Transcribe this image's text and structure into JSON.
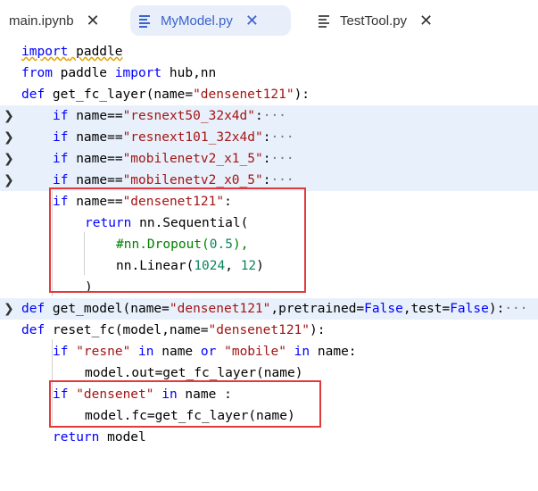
{
  "tabs": [
    {
      "label": "main.ipynb",
      "close": "✕"
    },
    {
      "label": "MyModel.py",
      "close": "✕"
    },
    {
      "label": "TestTool.py",
      "close": "✕"
    }
  ],
  "code": {
    "l1": {
      "kw": "import",
      "rest": " paddle"
    },
    "l2": {
      "kw1": "from",
      "mid": " paddle ",
      "kw2": "import",
      "rest": " hub,nn"
    },
    "l3": {
      "kw": "def",
      "a": " get_fc_layer(name=",
      "s": "\"densenet121\"",
      "b": "):"
    },
    "l4": {
      "kw": "if",
      "a": " name==",
      "s": "\"resnext50_32x4d\"",
      "b": ":",
      "e": "···"
    },
    "l5": {
      "kw": "if",
      "a": " name==",
      "s": "\"resnext101_32x4d\"",
      "b": ":",
      "e": "···"
    },
    "l6": {
      "kw": "if",
      "a": " name==",
      "s": "\"mobilenetv2_x1_5\"",
      "b": ":",
      "e": "···"
    },
    "l7": {
      "kw": "if",
      "a": " name==",
      "s": "\"mobilenetv2_x0_5\"",
      "b": ":",
      "e": "···"
    },
    "l8": {
      "kw": "if",
      "a": " name==",
      "s": "\"densenet121\"",
      "b": ":"
    },
    "l9": {
      "kw": "return",
      "a": " nn.Sequential("
    },
    "l10": {
      "c": "#nn.Dropout(",
      "n": "0.5",
      "d": "),"
    },
    "l11": {
      "a": "nn.Linear(",
      "n1": "1024",
      "m": ", ",
      "n2": "12",
      "b": ")"
    },
    "l12": {
      "a": ")"
    },
    "l13": {
      "kw": "def",
      "a": " get_model(name=",
      "s": "\"densenet121\"",
      "b": ",pretrained=",
      "f1": "False",
      "c": ",test=",
      "f2": "False",
      "d": "):",
      "e": "···"
    },
    "l14": {
      "kw": "def",
      "a": " reset_fc(model,name=",
      "s": "\"densenet121\"",
      "b": "):"
    },
    "l15": {
      "kw": "if",
      "s1": " \"resne\"",
      "k2": " in",
      "a": " name ",
      "k3": "or",
      "s2": " \"mobile\"",
      "k4": " in",
      "b": " name:"
    },
    "l16": {
      "a": "model.out=get_fc_layer(name)"
    },
    "l17": {
      "kw": "if",
      "s": " \"densenet\"",
      "k2": " in",
      "a": " name :"
    },
    "l18": {
      "a": "model.fc=get_fc_layer(name)"
    },
    "l19": {
      "kw": "return",
      "a": " model"
    }
  },
  "chevron": "❯",
  "colors": {
    "highlight": "#e8f1fb",
    "keyword": "#0000ff",
    "string": "#a31515",
    "annotation": "#e03a3a"
  }
}
